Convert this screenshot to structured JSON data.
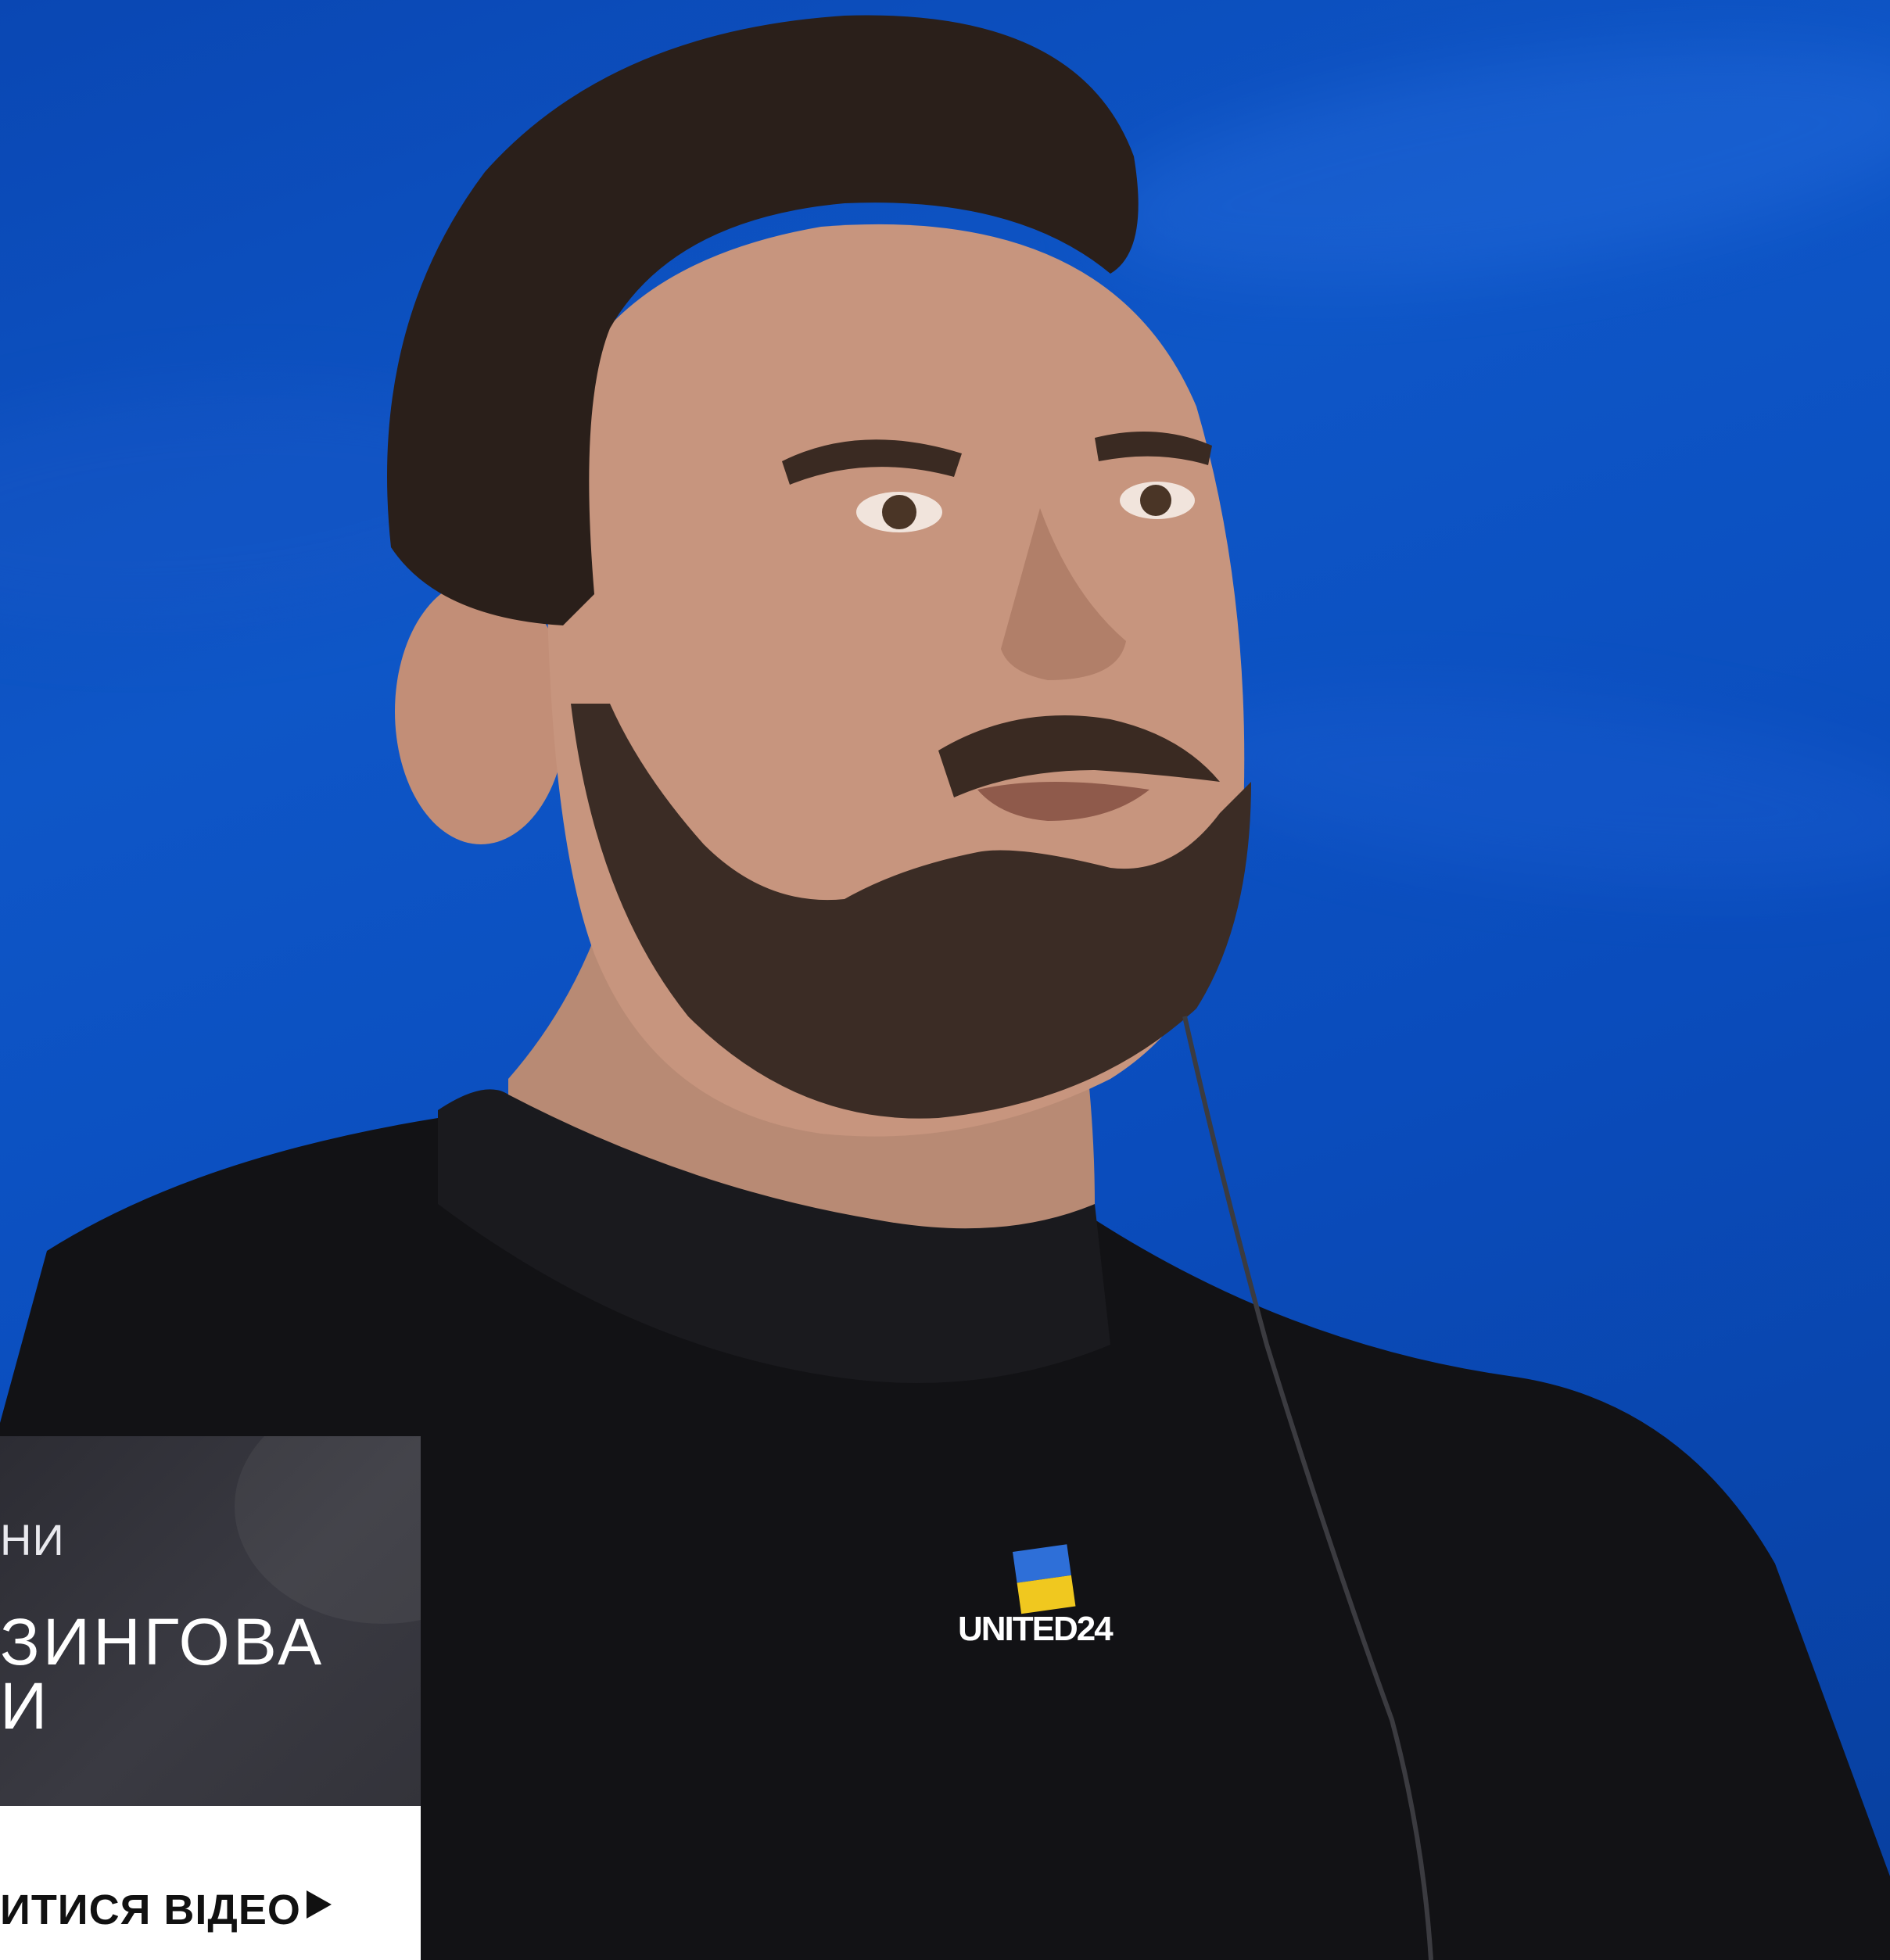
{
  "hero": {
    "background_color": "#0b4fb8",
    "sweater_logo_text": "UNITED24"
  },
  "card": {
    "kicker": "НИ",
    "headline_line1": "ЗИНГОВА",
    "headline_line2": "И",
    "watch_label": "ИТИСЯ ВІДЕО",
    "play_icon": "play-icon"
  }
}
